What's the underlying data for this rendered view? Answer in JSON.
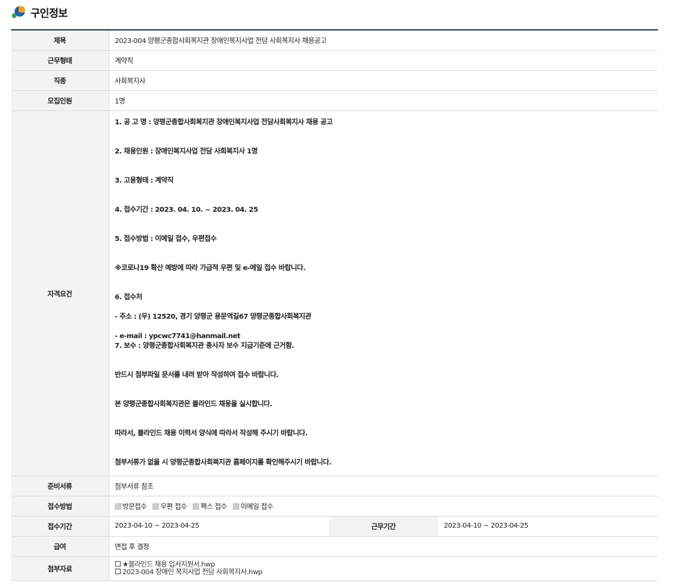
{
  "page": {
    "title": "구인정보"
  },
  "rows": {
    "title": {
      "label": "제목",
      "value": "2023-004 양평군종합사회복지관 장애인복지사업 전담 사회복지사 채용공고"
    },
    "work_type": {
      "label": "근무형태",
      "value": "계약직"
    },
    "job": {
      "label": "직종",
      "value": "사회복지사"
    },
    "headcount": {
      "label": "모집인원",
      "value": "1명"
    },
    "qualification": {
      "label": "자격요건",
      "lines": [
        "1. 공 고 명 : 양평군종합사회복지관 장애인복지사업 전담사회복지사 채용 공고",
        "",
        "",
        "2. 채용인원 : 장애인복지사업 전담 사회복지사 1명",
        "",
        "",
        "3. 고용형태 : 계약직",
        "",
        "",
        "4. 접수기간 : 2023. 04. 10. ~ 2023. 04. 25",
        "",
        "",
        "5. 접수방법 : 이메일 접수, 우편접수",
        "",
        "",
        "※코로나19 확산 예방에 따라 가급적 우편 및 e-메일 접수 바랍니다.",
        "",
        "",
        "6. 접수처",
        "",
        "- 주소 : (우) 12520, 경기 양평군 용문역길67 양평군종합사회복지관",
        "",
        "- e-mail : ypcwc7741@hanmail.net",
        "7. 보수 : 양평군종합사회복지관 종사자 보수 지급기준에 근거함.",
        "",
        "",
        "반드시 첨부파일 문서를 내려 받아 작성하여 접수 바랍니다.",
        "",
        "",
        "본 양평군종합사회복지관은 블라인드 채용을 실시합니다.",
        "",
        "",
        "따라서, 블라인드 채용 이력서 양식에 따라서 작성해 주시기 바랍니다.",
        "",
        "",
        "첨부서류가 없을 시 양평군종합사회복지관 홈페이지를 확인해주시기 바랍니다."
      ]
    },
    "documents": {
      "label": "준비서류",
      "value": "첨부서류 참조"
    },
    "apply_method": {
      "label": "접수방법",
      "options": [
        "방문접수",
        "우편 접수",
        "팩스 접수",
        "이메일 접수"
      ]
    },
    "apply_period": {
      "label": "접수기간",
      "value": "2023-04-10 ~ 2023-04-25",
      "label2": "근무기간",
      "value2": "2023-04-10 ~ 2023-04-25"
    },
    "salary": {
      "label": "급여",
      "value": "면접 후 결정"
    },
    "attachments": {
      "label": "첨부자료",
      "files": [
        "★블라인드 채용 입사지원서.hwp",
        "2023-004 장애인 복지사업 전담 사회복지사.hwp"
      ]
    }
  }
}
